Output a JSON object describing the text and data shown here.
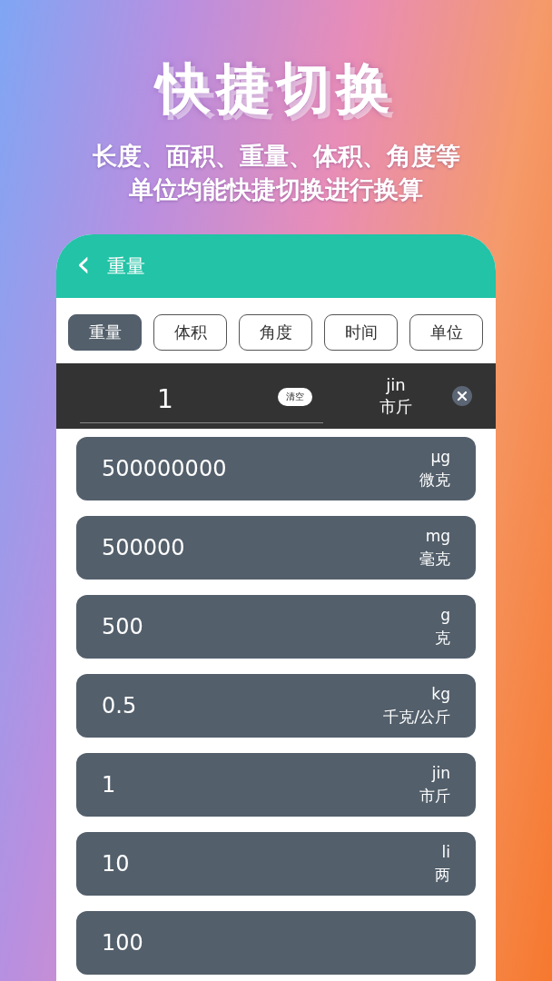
{
  "headline": "快捷切换",
  "subtitle": [
    "长度、面积、重量、体积、角度等",
    "单位均能快捷切换进行换算"
  ],
  "app_bar": {
    "back": "‹",
    "title": "重量"
  },
  "tabs": [
    {
      "label": "重量",
      "selected": true
    },
    {
      "label": "体积",
      "selected": false
    },
    {
      "label": "角度",
      "selected": false
    },
    {
      "label": "时间",
      "selected": false
    },
    {
      "label": "单位",
      "selected": false
    }
  ],
  "input": {
    "value": "1",
    "clear_label": "清空",
    "unit_code": "jin",
    "unit_name": "市斤"
  },
  "results": [
    {
      "value": "500000000",
      "unit_code": "μg",
      "unit_name": "微克"
    },
    {
      "value": "500000",
      "unit_code": "mg",
      "unit_name": "毫克"
    },
    {
      "value": "500",
      "unit_code": "g",
      "unit_name": "克"
    },
    {
      "value": "0.5",
      "unit_code": "kg",
      "unit_name": "千克/公斤"
    },
    {
      "value": "1",
      "unit_code": "jin",
      "unit_name": "市斤"
    },
    {
      "value": "10",
      "unit_code": "li",
      "unit_name": "两"
    },
    {
      "value": "100"
    }
  ]
}
